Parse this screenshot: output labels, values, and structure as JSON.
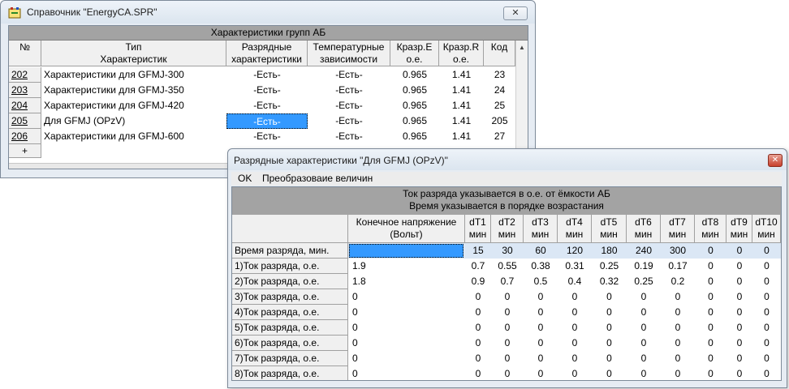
{
  "main_window": {
    "title": "Справочник \"EnergyCA.SPR\"",
    "close_label": "✕",
    "group_header": "Характеристики групп АБ",
    "columns": [
      {
        "l1": "№",
        "l2": ""
      },
      {
        "l1": "Тип",
        "l2": "Характеристик"
      },
      {
        "l1": "Разрядные",
        "l2": "характеристики"
      },
      {
        "l1": "Температурные",
        "l2": "зависимости"
      },
      {
        "l1": "Кразр.E",
        "l2": "о.е."
      },
      {
        "l1": "Кразр.R",
        "l2": "о.е."
      },
      {
        "l1": "Код",
        "l2": ""
      }
    ],
    "rows": [
      {
        "id": "202",
        "type": "Характеристики для GFMJ-300",
        "discharge": "-Есть-",
        "temp": "-Есть-",
        "ke": "0.965",
        "kr": "1.41",
        "code": "23"
      },
      {
        "id": "203",
        "type": "Характеристики для GFMJ-350",
        "discharge": "-Есть-",
        "temp": "-Есть-",
        "ke": "0.965",
        "kr": "1.41",
        "code": "24"
      },
      {
        "id": "204",
        "type": "Характеристики для GFMJ-420",
        "discharge": "-Есть-",
        "temp": "-Есть-",
        "ke": "0.965",
        "kr": "1.41",
        "code": "25"
      },
      {
        "id": "205",
        "type": "Для GFMJ (OPzV)",
        "discharge": "-Есть-",
        "temp": "-Есть-",
        "ke": "0.965",
        "kr": "1.41",
        "code": "205"
      },
      {
        "id": "206",
        "type": "Характеристики для GFMJ-600",
        "discharge": "-Есть-",
        "temp": "-Есть-",
        "ke": "0.965",
        "kr": "1.41",
        "code": "27"
      }
    ],
    "new_row_marker": "+",
    "selected_row": 3,
    "selection_color": "#3399ff"
  },
  "dialog": {
    "title": "Разрядные характеристики \"Для GFMJ (OPzV)\"",
    "close_label": "✕",
    "menu": [
      "OK",
      "Преобразоваие величин"
    ],
    "note1": "Ток разряда указывается в о.е. от ёмкости АБ",
    "note2": "Время указывается в порядке возрастания",
    "voltage_header": {
      "l1": "Конечное напряжение",
      "l2": "(Вольт)"
    },
    "dt_headers": [
      {
        "l1": "dT1",
        "l2": "мин"
      },
      {
        "l1": "dT2",
        "l2": "мин"
      },
      {
        "l1": "dT3",
        "l2": "мин"
      },
      {
        "l1": "dT4",
        "l2": "мин"
      },
      {
        "l1": "dT5",
        "l2": "мин"
      },
      {
        "l1": "dT6",
        "l2": "мин"
      },
      {
        "l1": "dT7",
        "l2": "мин"
      },
      {
        "l1": "dT8",
        "l2": "мин"
      },
      {
        "l1": "dT9",
        "l2": "мин"
      },
      {
        "l1": "dT10",
        "l2": "мин"
      }
    ],
    "time_row": {
      "label": "Время разряда, мин.",
      "voltage": "",
      "values": [
        "15",
        "30",
        "60",
        "120",
        "180",
        "240",
        "300",
        "0",
        "0",
        "0"
      ]
    },
    "current_rows": [
      {
        "label": "1)Ток разряда, о.е.",
        "voltage": "1.9",
        "values": [
          "0.7",
          "0.55",
          "0.38",
          "0.31",
          "0.25",
          "0.19",
          "0.17",
          "0",
          "0",
          "0"
        ]
      },
      {
        "label": "2)Ток разряда, о.е.",
        "voltage": "1.8",
        "values": [
          "0.9",
          "0.7",
          "0.5",
          "0.4",
          "0.32",
          "0.25",
          "0.2",
          "0",
          "0",
          "0"
        ]
      },
      {
        "label": "3)Ток разряда, о.е.",
        "voltage": "0",
        "values": [
          "0",
          "0",
          "0",
          "0",
          "0",
          "0",
          "0",
          "0",
          "0",
          "0"
        ]
      },
      {
        "label": "4)Ток разряда, о.е.",
        "voltage": "0",
        "values": [
          "0",
          "0",
          "0",
          "0",
          "0",
          "0",
          "0",
          "0",
          "0",
          "0"
        ]
      },
      {
        "label": "5)Ток разряда, о.е.",
        "voltage": "0",
        "values": [
          "0",
          "0",
          "0",
          "0",
          "0",
          "0",
          "0",
          "0",
          "0",
          "0"
        ]
      },
      {
        "label": "6)Ток разряда, о.е.",
        "voltage": "0",
        "values": [
          "0",
          "0",
          "0",
          "0",
          "0",
          "0",
          "0",
          "0",
          "0",
          "0"
        ]
      },
      {
        "label": "7)Ток разряда, о.е.",
        "voltage": "0",
        "values": [
          "0",
          "0",
          "0",
          "0",
          "0",
          "0",
          "0",
          "0",
          "0",
          "0"
        ]
      },
      {
        "label": "8)Ток разряда, о.е.",
        "voltage": "0",
        "values": [
          "0",
          "0",
          "0",
          "0",
          "0",
          "0",
          "0",
          "0",
          "0",
          "0"
        ]
      }
    ],
    "header_bg": "#a3a3a3",
    "highlight_row_color": "#dbe7f5"
  }
}
